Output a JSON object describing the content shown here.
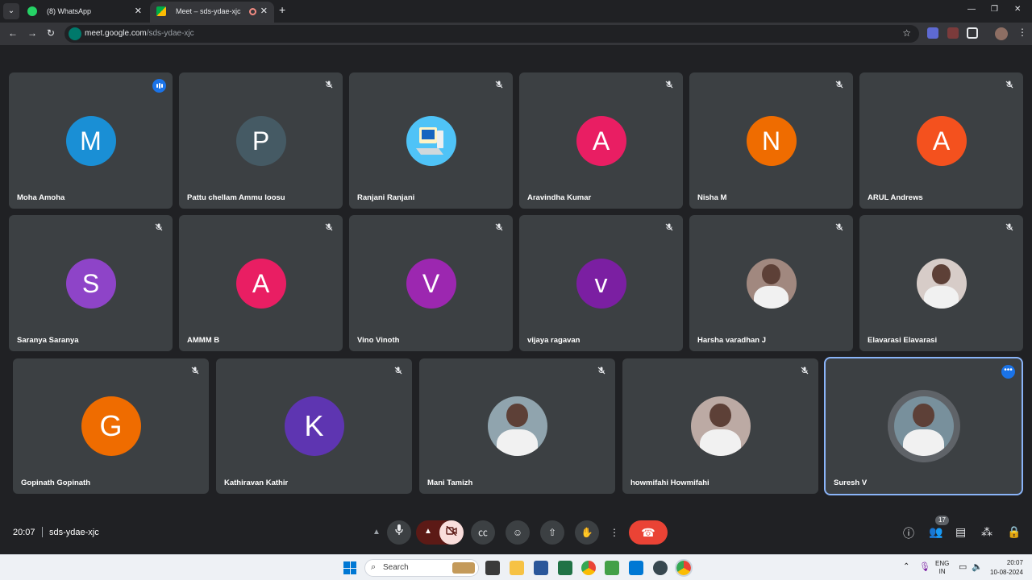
{
  "browser": {
    "tabs": [
      {
        "title": "(8) WhatsApp",
        "close": "✕"
      },
      {
        "title": "Meet – sds-ydae-xjc",
        "close": "✕"
      }
    ],
    "new_tab": "+",
    "window_controls": {
      "minimize": "—",
      "restore": "❐",
      "close": "✕"
    },
    "url_host": "meet.google.com",
    "url_path": "/sds-ydae-xjc"
  },
  "tiles": [
    {
      "name": "Moha Amoha",
      "initial": "M",
      "color": "#1a8fd5",
      "status": "speaking"
    },
    {
      "name": "Pattu chellam Ammu loosu",
      "initial": "P",
      "color": "#455a64",
      "status": "muted"
    },
    {
      "name": "Ranjani Ranjani",
      "initial": "",
      "color": "#4fc3f7",
      "status": "muted",
      "picture": "computer"
    },
    {
      "name": "Aravindha Kumar",
      "initial": "A",
      "color": "#e91e63",
      "status": "muted"
    },
    {
      "name": "Nisha M",
      "initial": "N",
      "color": "#ef6c00",
      "status": "muted"
    },
    {
      "name": "ARUL Andrews",
      "initial": "A",
      "color": "#f4511e",
      "status": "muted"
    },
    {
      "name": "Saranya Saranya",
      "initial": "S",
      "color": "#8e44c8",
      "status": "muted"
    },
    {
      "name": "AMMM B",
      "initial": "A",
      "color": "#e91e63",
      "status": "muted"
    },
    {
      "name": "Vino Vinoth",
      "initial": "V",
      "color": "#9c27b0",
      "status": "muted"
    },
    {
      "name": "vijaya ragavan",
      "initial": "v",
      "color": "#7b1fa2",
      "status": "muted"
    },
    {
      "name": "Harsha varadhan J",
      "initial": "",
      "color": "#a1887f",
      "status": "muted",
      "picture": "photo"
    },
    {
      "name": "Elavarasi Elavarasi",
      "initial": "",
      "color": "#d7ccc8",
      "status": "muted",
      "picture": "photo"
    },
    {
      "name": "Gopinath Gopinath",
      "initial": "G",
      "color": "#ef6c00",
      "status": "muted"
    },
    {
      "name": "Kathiravan Kathir",
      "initial": "K",
      "color": "#5e35b1",
      "status": "muted"
    },
    {
      "name": "Mani Tamizh",
      "initial": "",
      "color": "#90a4ae",
      "status": "muted",
      "picture": "photo"
    },
    {
      "name": "howmifahi Howmifahi",
      "initial": "",
      "color": "#bcaaa4",
      "status": "muted",
      "picture": "photo"
    },
    {
      "name": "Suresh V",
      "initial": "",
      "color": "#78909c",
      "status": "more",
      "picture": "photo",
      "active": true
    }
  ],
  "meeting": {
    "time": "20:07",
    "code": "sds-ydae-xjc",
    "participant_count": "17",
    "colors": {
      "leave": "#ea4335",
      "cam_off_bg": "#f9dedc",
      "accent": "#8ab4f8"
    }
  },
  "taskbar": {
    "search_label": "Search",
    "lang_line1": "ENG",
    "lang_line2": "IN",
    "clock_time": "20:07",
    "clock_date": "10-08-2024"
  }
}
